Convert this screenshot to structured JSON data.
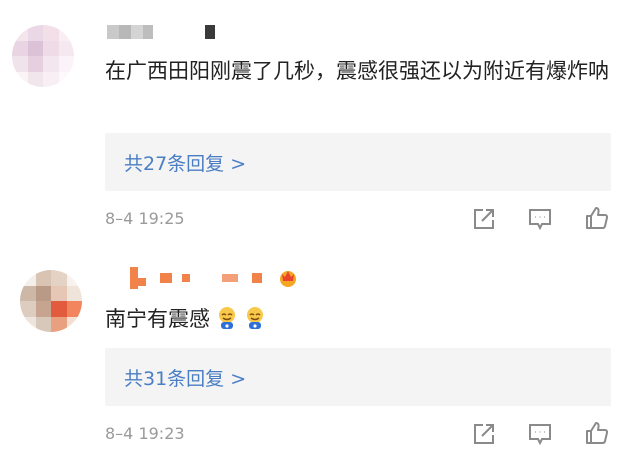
{
  "comments": [
    {
      "content": "在广西田阳刚震了几秒，震感很强还以为附近有爆炸呐",
      "replies_label": "共27条回复 >",
      "time": "8–4 19:25"
    },
    {
      "content": "南宁有震感",
      "content_emojis": [
        "crying-face-emoji",
        "crying-face-emoji"
      ],
      "replies_label": "共31条回复 >",
      "time": "8–4 19:23"
    }
  ],
  "actions": [
    "share-icon",
    "comment-icon",
    "like-icon"
  ],
  "colors": {
    "reply_text": "#4a7ec4",
    "reply_bg": "#f4f4f4",
    "meta_text": "#9a9a9a",
    "icon": "#8a8a8a",
    "nickname_orange": "#f0824a"
  }
}
